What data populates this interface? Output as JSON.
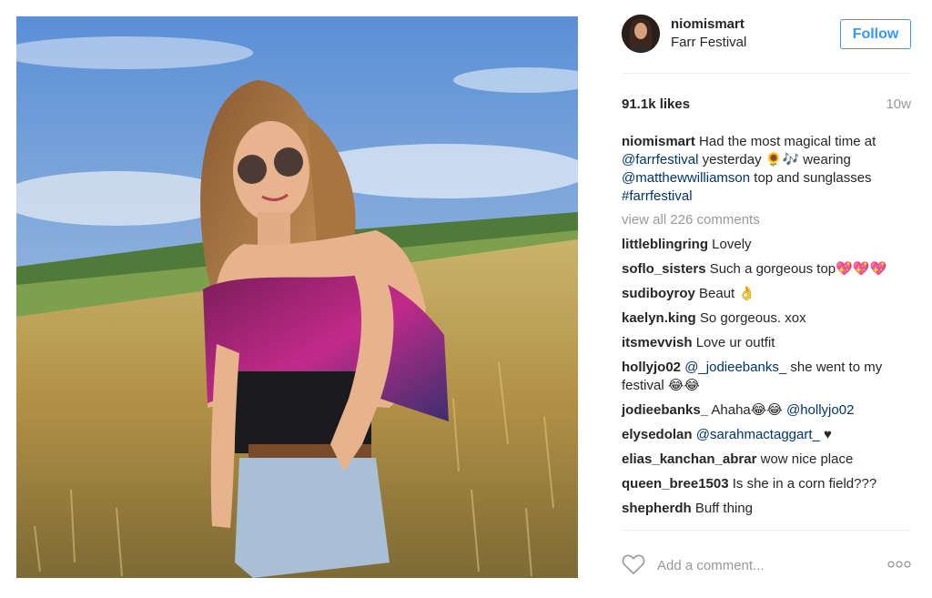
{
  "post": {
    "image_alt": "Woman in sunglasses standing in a wheat field",
    "username": "niomismart",
    "location": "Farr Festival",
    "follow_label": "Follow",
    "likes": "91.1k likes",
    "time": "10w",
    "caption": {
      "username": "niomismart",
      "t1": " Had the most magical time at ",
      "link1": "@farrfestival",
      "t2": " yesterday 🌻🎶 wearing ",
      "link2": "@matthewwilliamson",
      "t3": " top and sunglasses ",
      "link3": "#farrfestival"
    },
    "view_all": "view all 226 comments",
    "comments": [
      {
        "user": "littleblingring",
        "text": " Lovely"
      },
      {
        "user": "soflo_sisters",
        "text": " Such a gorgeous top💖💖💖"
      },
      {
        "user": "sudiboyroy",
        "text": " Beaut 👌"
      },
      {
        "user": "kaelyn.king",
        "text": " So gorgeous. xox"
      },
      {
        "user": "itsmevvish",
        "text": " Love ur outfit"
      },
      {
        "user": "hollyjo02",
        "link": "@_jodieebanks_",
        "text": " she went to my festival 😂😂"
      },
      {
        "user": "jodieebanks_",
        "text": " Ahaha😂😂 ",
        "link": "@hollyjo02"
      },
      {
        "user": "elysedolan",
        "link": "@sarahmactaggart_",
        "text": " ♥"
      },
      {
        "user": "elias_kanchan_abrar",
        "text": " wow nice place"
      },
      {
        "user": "queen_bree1503",
        "text": " Is she in a corn field???"
      },
      {
        "user": "shepherdh",
        "text": " Buff thing"
      }
    ],
    "add_comment_placeholder": "Add a comment...",
    "icons": {
      "like": "heart-icon",
      "more": "more-options-icon"
    },
    "colors": {
      "accent": "#3897f0",
      "link": "#003569",
      "muted": "#999999"
    }
  }
}
